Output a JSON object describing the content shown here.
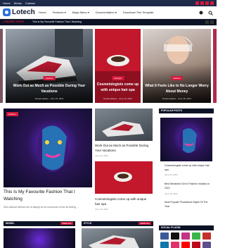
{
  "topbar": {
    "links": [
      "Home",
      "Works",
      "Contact"
    ]
  },
  "header": {
    "logo_text": "Lotech",
    "nav": [
      "Home",
      "Features ▾",
      "Mega Menu ▾",
      "Documentation ▾",
      "Download This Template"
    ]
  },
  "ticker": {
    "label": "● RECENT POSTS",
    "text": "This Is My Favourite Fashion That I Watching"
  },
  "slider": [
    {
      "category": "",
      "title": "",
      "meta": ""
    },
    {
      "category": "Fashion",
      "title": "Work Out as Much as Possible During Your Vacations",
      "meta": "Soratemplates · June 15, 2021"
    },
    {
      "category": "Lifestyle",
      "title": "Cosmetologists come up with unique hair spa",
      "meta": "Soratemplates · June 15, 2021"
    },
    {
      "category": "Fashion",
      "title": "What It Feels Like to No Longer Worry About Money",
      "meta": "Soratemplates · June 15, 2021"
    }
  ],
  "feature": {
    "category": "Fashion",
    "title": "This Is My Favourite Fashion That I Watching",
    "meta": "Sed ullamco laboris nisi ut aliquip ex ea commodo of the all writing ..."
  },
  "middle": [
    {
      "title": "Work Out as Much as Possible During Your Vacations",
      "meta": "June 15, 2021"
    },
    {
      "title": "Cosmetologists come up with unique hair spa",
      "meta": "June 15, 2021"
    }
  ],
  "sidebar": {
    "popular_heading": "POPULAR POSTS",
    "items": [
      {
        "title": "Cosmetologists come up with unique hair spa",
        "meta": "June 15, 2021"
      },
      {
        "title": "Best Streamed Girl In Fashion Industry In 2021",
        "meta": "June 15, 2021"
      },
      {
        "title": "Most Popular Photoshoot Styles Of The Year",
        "meta": "June 15, 2021"
      }
    ],
    "social_heading": "SOCIAL PLUGIN"
  },
  "sections": [
    {
      "label": "MODEL",
      "more": "VIEW ALL"
    },
    {
      "label": "STYLE",
      "more": "VIEW ALL"
    }
  ],
  "colors": {
    "accent": "#d5183b",
    "navy": "#0d1326",
    "brand": "#2a6fdb"
  }
}
